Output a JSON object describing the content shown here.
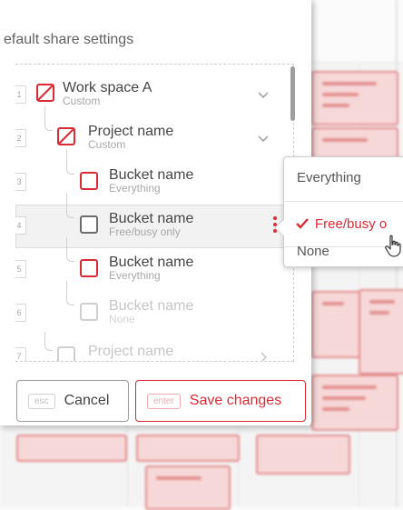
{
  "panel": {
    "title": "efault share settings"
  },
  "rows": [
    {
      "num": "1",
      "label": "Work space A",
      "sub": "Custom"
    },
    {
      "num": "2",
      "label": "Project name",
      "sub": "Custom"
    },
    {
      "num": "3",
      "label": "Bucket name",
      "sub": "Everything"
    },
    {
      "num": "4",
      "label": "Bucket name",
      "sub": "Free/busy only"
    },
    {
      "num": "5",
      "label": "Bucket name",
      "sub": "Everything"
    },
    {
      "num": "6",
      "label": "Bucket name",
      "sub": "None"
    },
    {
      "num": "7",
      "label": "Project name",
      "sub": ""
    }
  ],
  "footer": {
    "cancel_key": "esc",
    "cancel_label": "Cancel",
    "save_key": "enter",
    "save_label": "Save changes"
  },
  "menu": {
    "items": [
      "Everything",
      "Free/busy o",
      "None"
    ],
    "selected_index": 1
  },
  "colors": {
    "accent": "#d92b35",
    "text": "#454545",
    "subtext": "#a8a8a8"
  }
}
